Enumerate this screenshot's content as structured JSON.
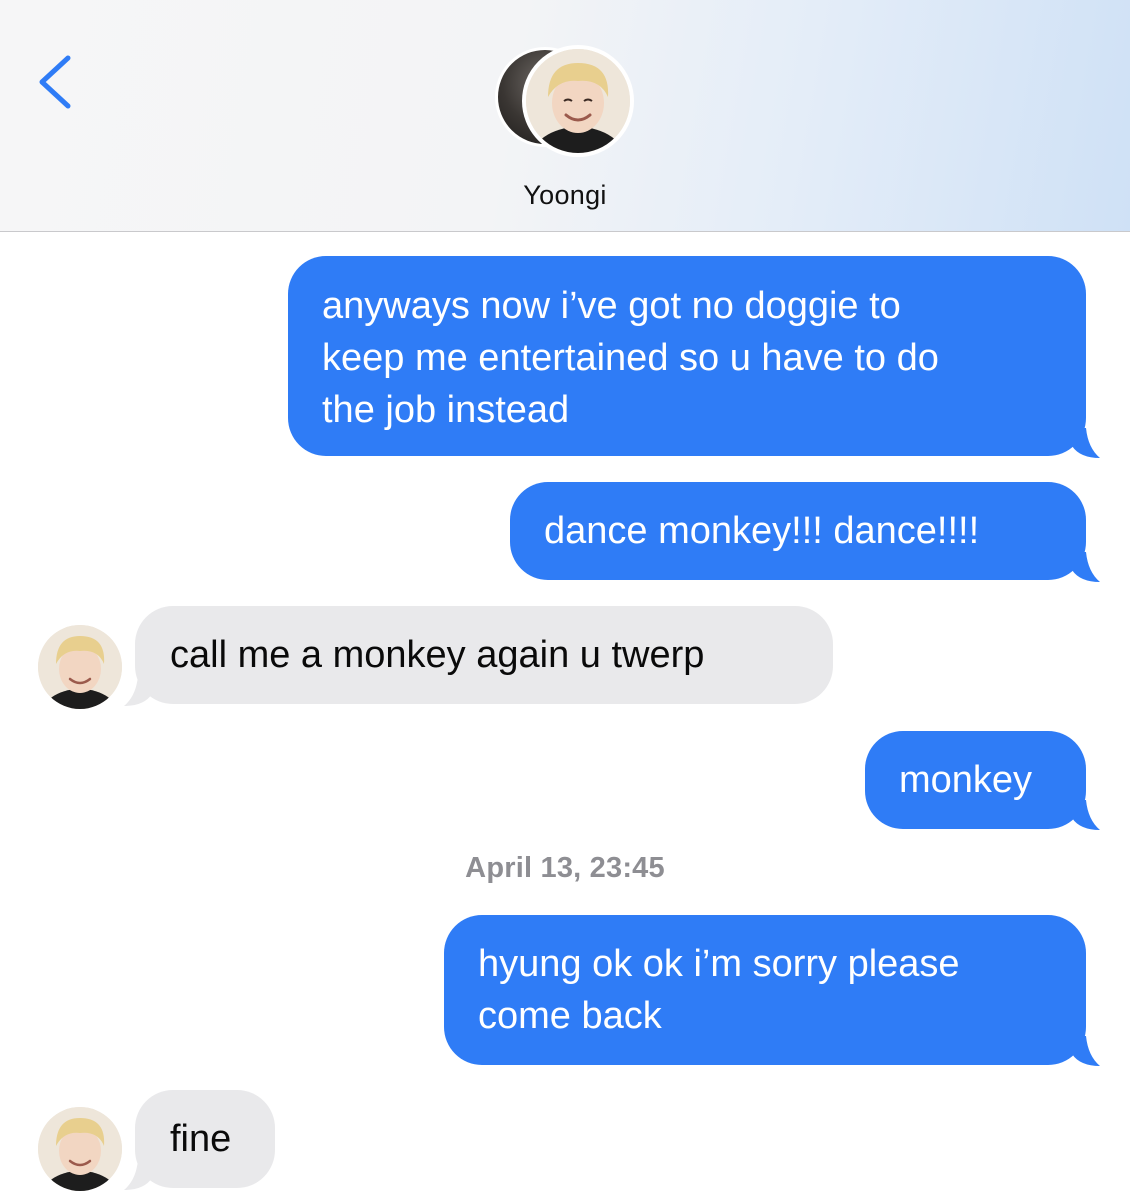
{
  "header": {
    "contact_name": "Yoongi",
    "back_icon": "chevron-left-icon",
    "accent_color": "#2f7cf6"
  },
  "messages": [
    {
      "side": "out",
      "text": "anyways now i’ve got no doggie to\nkeep me entertained so u have to do\nthe job instead"
    },
    {
      "side": "out",
      "text": "dance monkey!!! dance!!!!"
    },
    {
      "side": "in",
      "text": "call me a monkey again u twerp"
    },
    {
      "side": "out",
      "text": "monkey"
    },
    {
      "side": "out",
      "text": "hyung ok ok i’m sorry please\ncome back"
    },
    {
      "side": "in",
      "text": "fine"
    }
  ],
  "timestamp": "April 13, 23:45",
  "colors": {
    "outgoing_bubble": "#2f7cf6",
    "incoming_bubble": "#e9e9eb",
    "timestamp_text": "#8e8e93"
  }
}
